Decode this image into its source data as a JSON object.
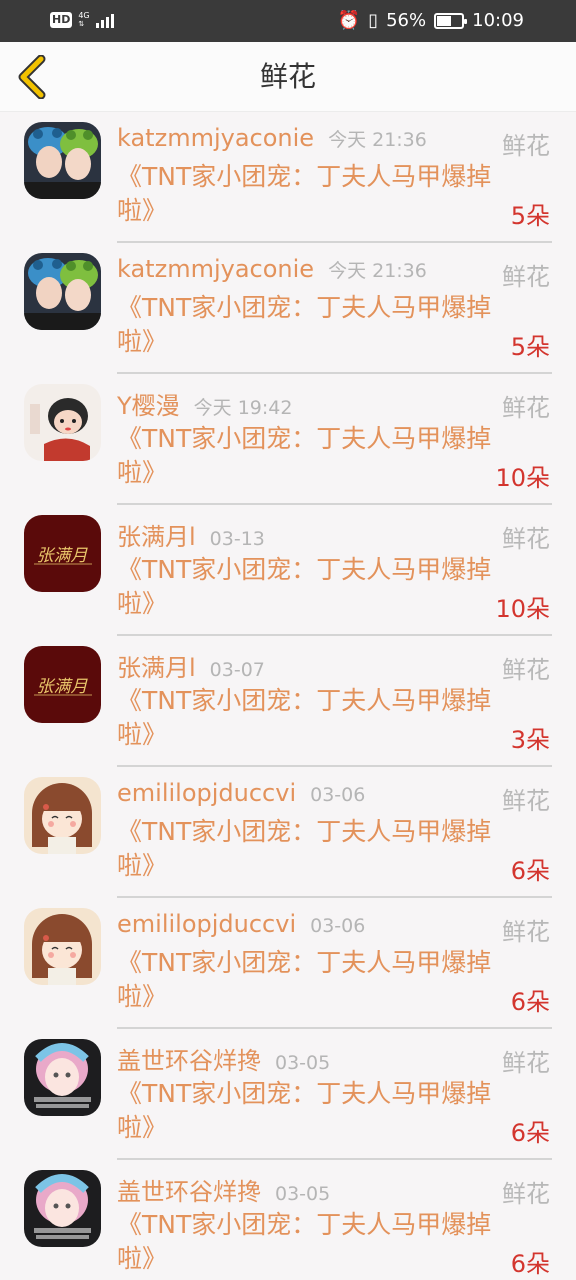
{
  "status_bar": {
    "hd": "HD",
    "network": "4G",
    "battery_pct": "56%",
    "battery_level": 0.56,
    "time": "10:09",
    "icons": [
      "alarm-icon",
      "vibrate-icon",
      "battery-icon",
      "signal-icon"
    ]
  },
  "header": {
    "title": "鲜花",
    "back_icon": "chevron-left-icon",
    "accent": "#e6b800"
  },
  "colors": {
    "username": "#e3925b",
    "count": "#d3352e",
    "muted": "#b5b5b5"
  },
  "items": [
    {
      "user": "katzmmjyaconie",
      "time": "今天 21:36",
      "gift": "鲜花",
      "book": "《TNT家小团宠：丁夫人马甲爆掉啦》",
      "count": "5朵",
      "avatar": "photo-two-kids"
    },
    {
      "user": "katzmmjyaconie",
      "time": "今天 21:36",
      "gift": "鲜花",
      "book": "《TNT家小团宠：丁夫人马甲爆掉啦》",
      "count": "5朵",
      "avatar": "photo-two-kids"
    },
    {
      "user": "Y樱漫",
      "time": "今天 19:42",
      "gift": "鲜花",
      "book": "《TNT家小团宠：丁夫人马甲爆掉啦》",
      "count": "10朵",
      "avatar": "cartoon-girl"
    },
    {
      "user": "张满月l",
      "time": "03-13",
      "gift": "鲜花",
      "book": "《TNT家小团宠：丁夫人马甲爆掉啦》",
      "count": "10朵",
      "avatar": "calligraphy",
      "avatar_text": "张满月"
    },
    {
      "user": "张满月l",
      "time": "03-07",
      "gift": "鲜花",
      "book": "《TNT家小团宠：丁夫人马甲爆掉啦》",
      "count": "3朵",
      "avatar": "calligraphy",
      "avatar_text": "张满月"
    },
    {
      "user": "emililopjduccvi",
      "time": "03-06",
      "gift": "鲜花",
      "book": "《TNT家小团宠：丁夫人马甲爆掉啦》",
      "count": "6朵",
      "avatar": "cartoon-brown-hair"
    },
    {
      "user": "emililopjduccvi",
      "time": "03-06",
      "gift": "鲜花",
      "book": "《TNT家小团宠：丁夫人马甲爆掉啦》",
      "count": "6朵",
      "avatar": "cartoon-brown-hair"
    },
    {
      "user": "盖世环谷烊搀",
      "time": "03-05",
      "gift": "鲜花",
      "book": "《TNT家小团宠：丁夫人马甲爆掉啦》",
      "count": "6朵",
      "avatar": "photo-pastel-girl"
    },
    {
      "user": "盖世环谷烊搀",
      "time": "03-05",
      "gift": "鲜花",
      "book": "《TNT家小团宠：丁夫人马甲爆掉啦》",
      "count": "6朵",
      "avatar": "photo-pastel-girl"
    }
  ]
}
